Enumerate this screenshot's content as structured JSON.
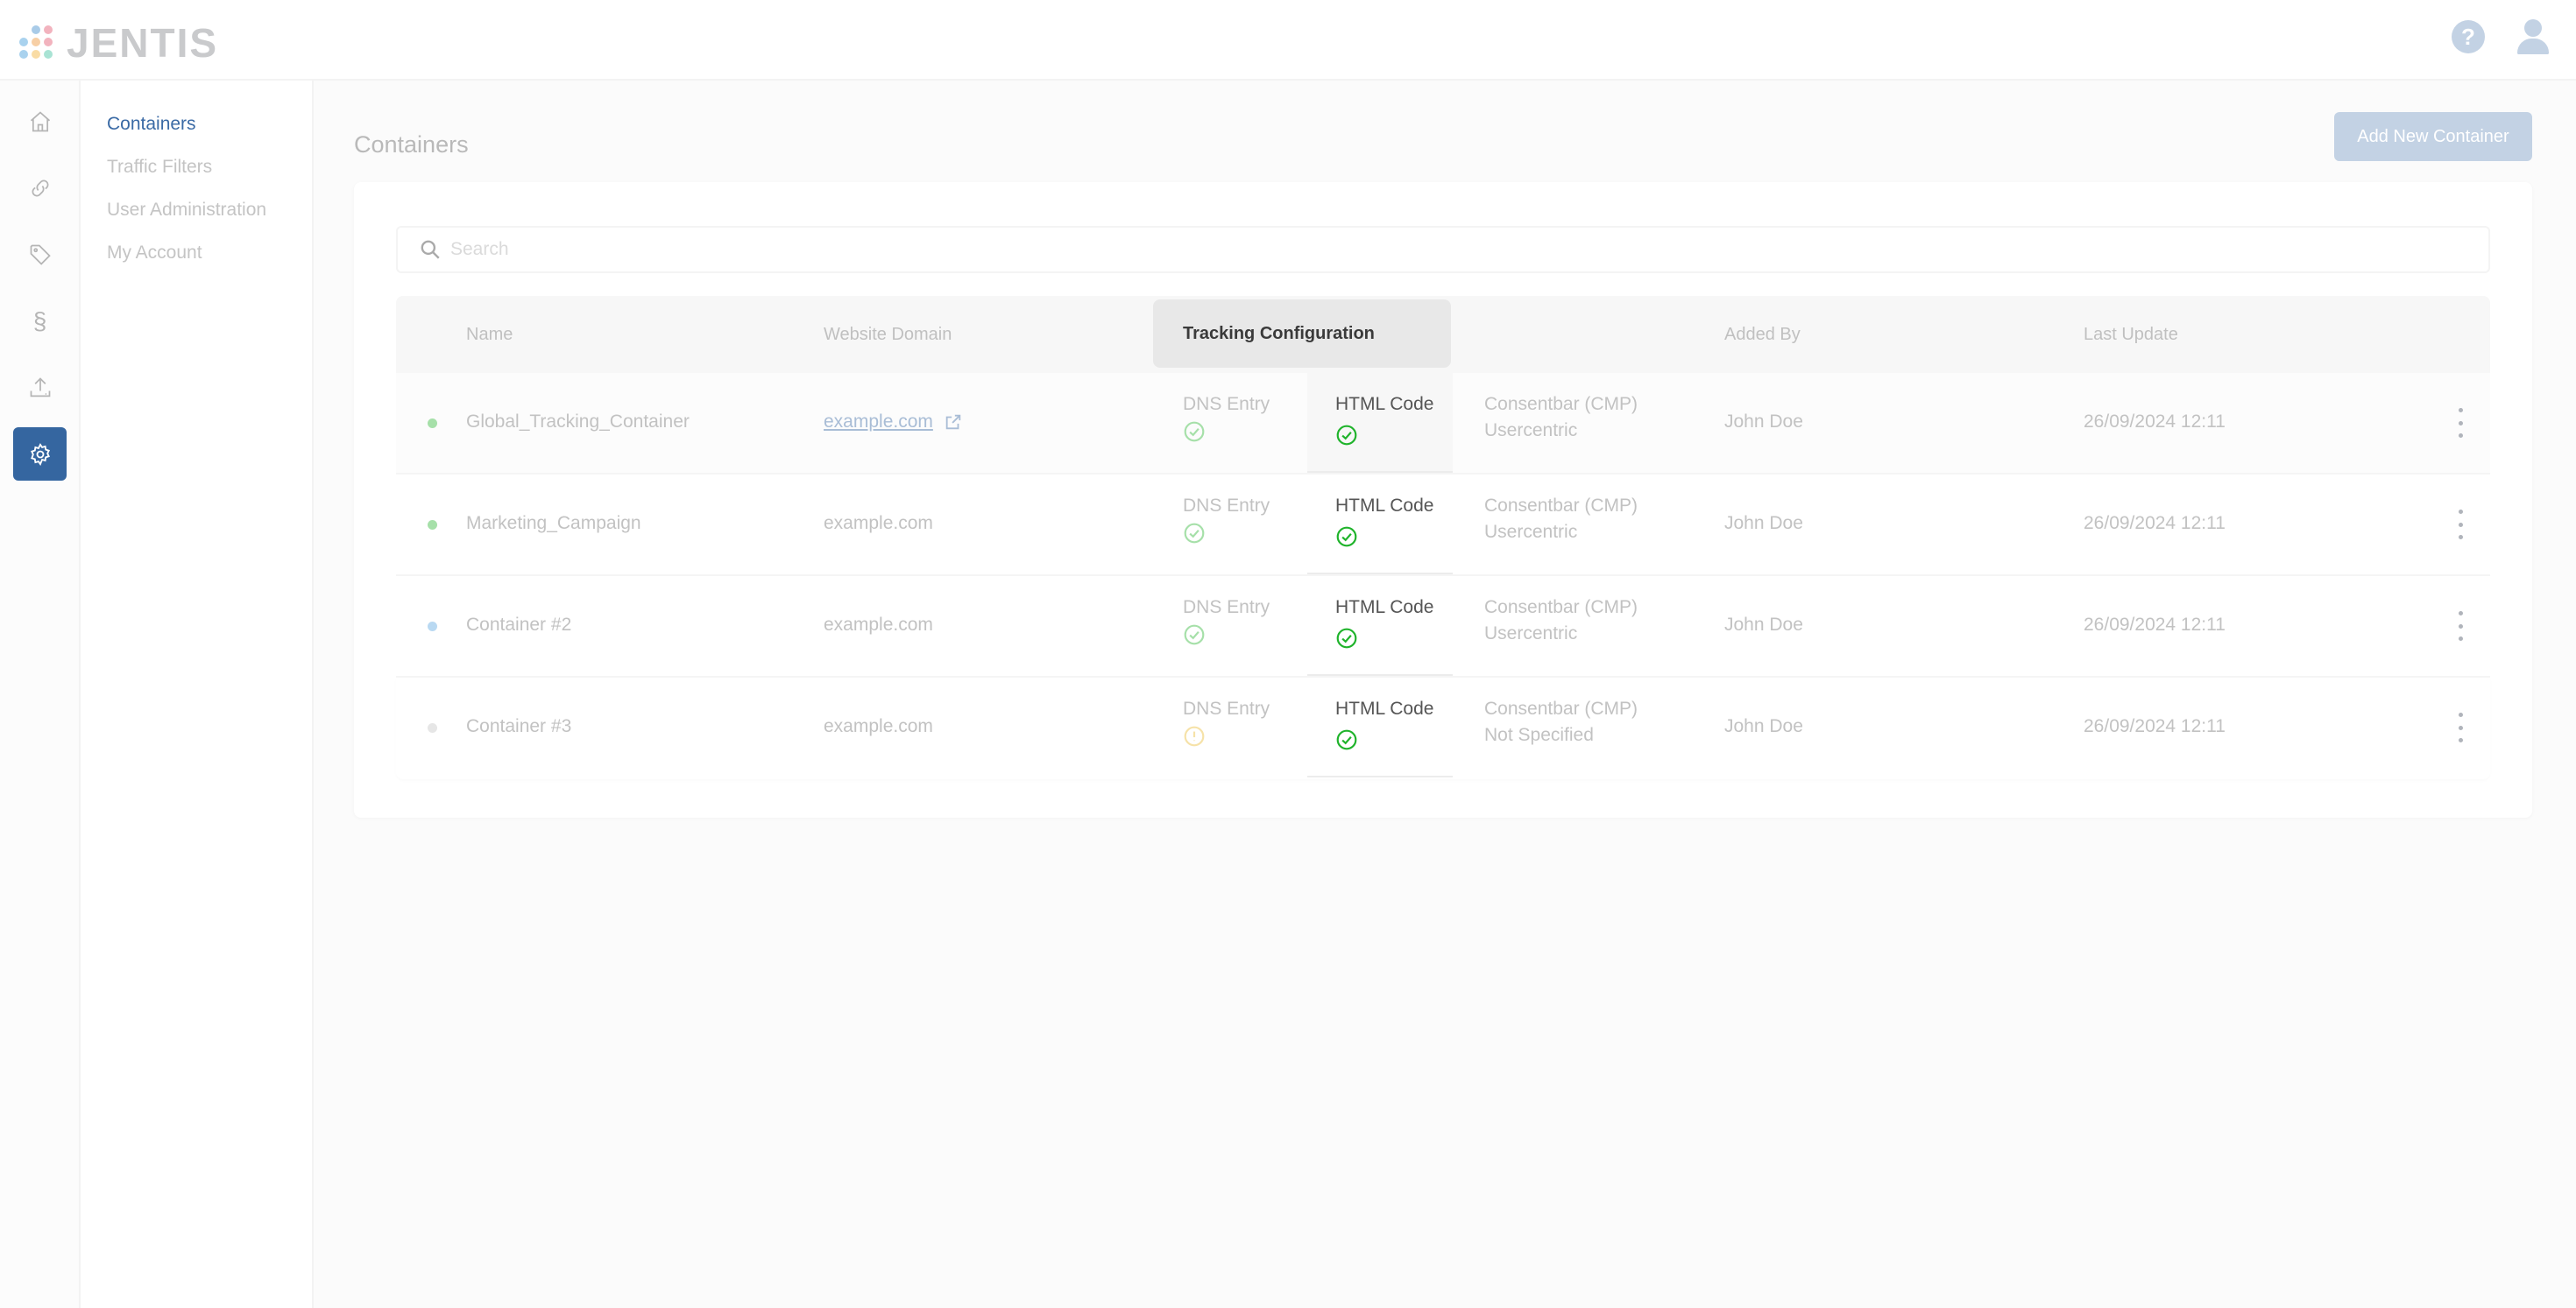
{
  "app": {
    "logo_text": "JENTIS"
  },
  "topbar": {
    "help_icon": "question-circle-icon",
    "user_icon": "user-icon"
  },
  "rail": {
    "items": [
      {
        "icon": "home-icon",
        "active": false
      },
      {
        "icon": "link-icon",
        "active": false
      },
      {
        "icon": "tag-icon",
        "active": false
      },
      {
        "icon": "section-sign-icon",
        "active": false
      },
      {
        "icon": "upload-icon",
        "active": false
      },
      {
        "icon": "gear-icon",
        "active": true
      }
    ],
    "section_glyph": "§"
  },
  "subnav": {
    "items": [
      {
        "label": "Containers",
        "active": true
      },
      {
        "label": "Traffic Filters",
        "active": false
      },
      {
        "label": "User Administration",
        "active": false
      },
      {
        "label": "My Account",
        "active": false
      }
    ]
  },
  "page": {
    "title": "Containers",
    "add_button": "Add New Container"
  },
  "search": {
    "placeholder": "Search",
    "value": ""
  },
  "table": {
    "columns": {
      "name": "Name",
      "domain": "Website Domain",
      "tracking": "Tracking Configuration",
      "added_by": "Added By",
      "last_update": "Last Update"
    },
    "rows": [
      {
        "status_color": "#a6e0a9",
        "name": "Global_Tracking_Container",
        "domain": "example.com",
        "domain_linked": true,
        "dns_label": "DNS Entry",
        "dns_status": "ok",
        "html_label": "HTML Code",
        "html_status": "ok",
        "cmp_label": "Consentbar (CMP)",
        "cmp_value": "Usercentric",
        "added_by": "John Doe",
        "last_update": "26/09/2024 12:11"
      },
      {
        "status_color": "#a6e0a9",
        "name": "Marketing_Campaign",
        "domain": "example.com",
        "domain_linked": false,
        "dns_label": "DNS Entry",
        "dns_status": "ok",
        "html_label": "HTML Code",
        "html_status": "ok",
        "cmp_label": "Consentbar (CMP)",
        "cmp_value": "Usercentric",
        "added_by": "John Doe",
        "last_update": "26/09/2024 12:11"
      },
      {
        "status_color": "#b9d9f2",
        "name": "Container #2",
        "domain": "example.com",
        "domain_linked": false,
        "dns_label": "DNS Entry",
        "dns_status": "ok",
        "html_label": "HTML Code",
        "html_status": "ok",
        "cmp_label": "Consentbar (CMP)",
        "cmp_value": "Usercentric",
        "added_by": "John Doe",
        "last_update": "26/09/2024 12:11"
      },
      {
        "status_color": "#e6e6e6",
        "name": "Container #3",
        "domain": "example.com",
        "domain_linked": false,
        "dns_label": "DNS Entry",
        "dns_status": "warning",
        "html_label": "HTML Code",
        "html_status": "ok",
        "cmp_label": "Consentbar (CMP)",
        "cmp_value": "Not Specified",
        "added_by": "John Doe",
        "last_update": "26/09/2024 12:11"
      }
    ]
  },
  "colors": {
    "accent": "#3566a0",
    "button_disabled": "#c3d2e4",
    "ok_strong": "#1fb32b",
    "ok_faded": "#a6e0a9",
    "warning_faded": "#f6e2a8"
  }
}
